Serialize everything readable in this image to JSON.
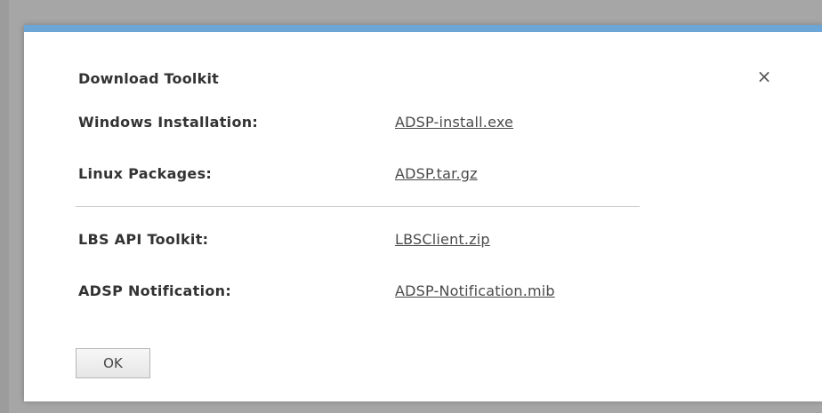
{
  "dialog": {
    "title": "Download Toolkit",
    "close_glyph": "×",
    "close_icon": "close-icon",
    "accent_color": "#6ca6d6",
    "rows": [
      {
        "label": "Windows Installation:",
        "link": "ADSP-install.exe"
      },
      {
        "label": "Linux Packages:",
        "link": "ADSP.tar.gz"
      },
      {
        "label": "LBS API Toolkit:",
        "link": "LBSClient.zip"
      },
      {
        "label": "ADSP Notification:",
        "link": "ADSP-Notification.mib"
      }
    ],
    "ok_label": "OK"
  }
}
